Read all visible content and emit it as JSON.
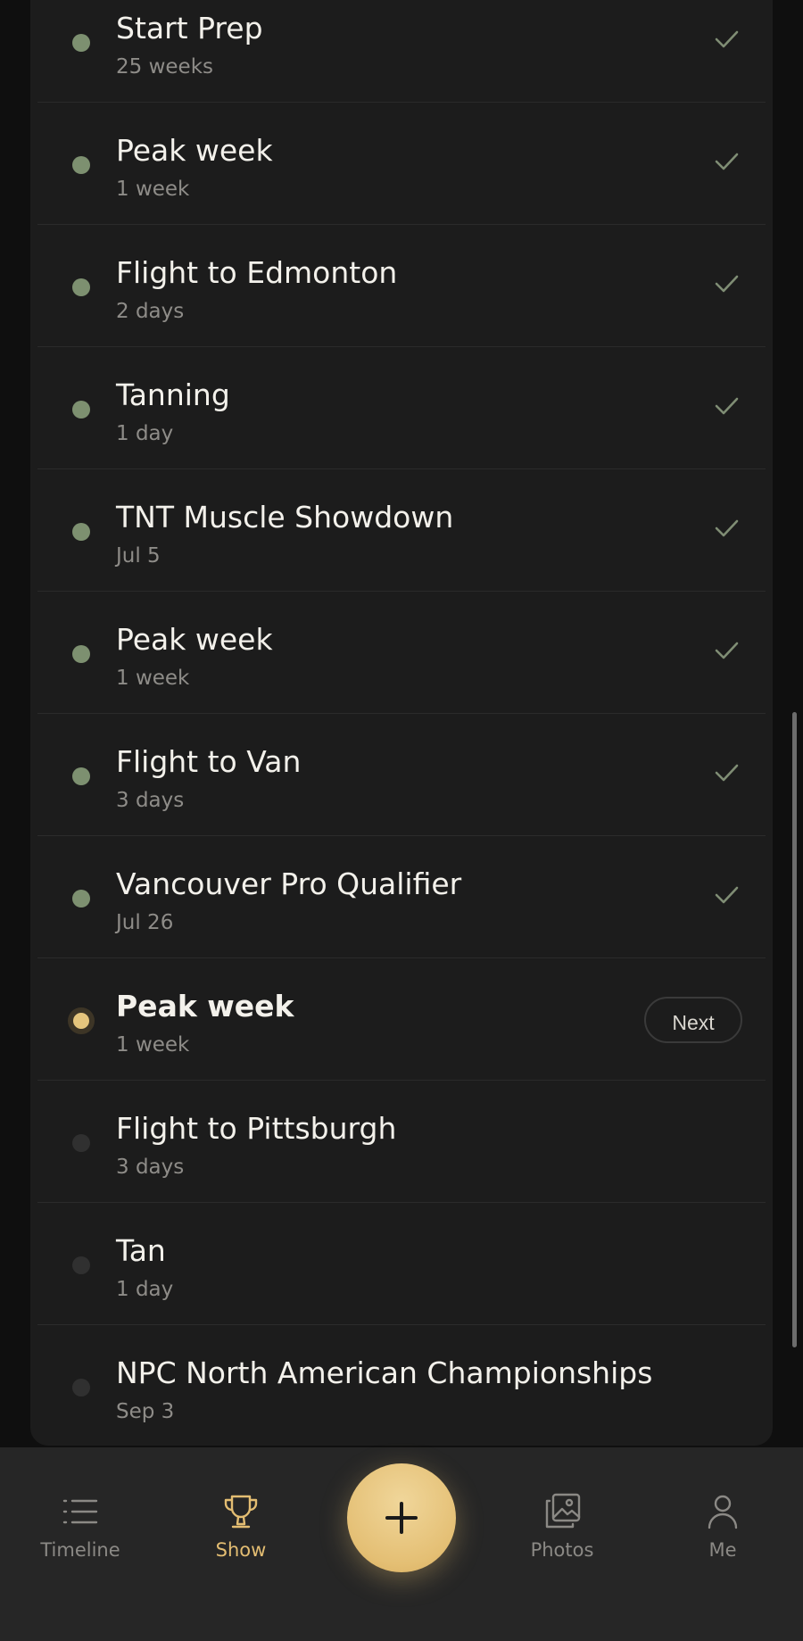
{
  "timeline": [
    {
      "title": "Start Prep",
      "subtitle": "25 weeks",
      "status": "done"
    },
    {
      "title": "Peak week",
      "subtitle": "1 week",
      "status": "done"
    },
    {
      "title": "Flight to Edmonton",
      "subtitle": "2 days",
      "status": "done"
    },
    {
      "title": "Tanning",
      "subtitle": "1 day",
      "status": "done"
    },
    {
      "title": "TNT Muscle Showdown",
      "subtitle": "Jul 5",
      "status": "done"
    },
    {
      "title": "Peak week",
      "subtitle": "1 week",
      "status": "done"
    },
    {
      "title": "Flight to Van",
      "subtitle": "3 days",
      "status": "done"
    },
    {
      "title": "Vancouver Pro Qualifier",
      "subtitle": "Jul 26",
      "status": "done"
    },
    {
      "title": "Peak week",
      "subtitle": "1 week",
      "status": "current",
      "action_label": "Next"
    },
    {
      "title": "Flight to Pittsburgh",
      "subtitle": "3 days",
      "status": "pending"
    },
    {
      "title": "Tan",
      "subtitle": "1 day",
      "status": "pending"
    },
    {
      "title": "NPC North American Championships",
      "subtitle": "Sep 3",
      "status": "pending"
    }
  ],
  "colors": {
    "done_dot": "#7d9070",
    "current_dot": "#e5c57d",
    "pending_dot": "#303030",
    "accent": "#e3bd72"
  },
  "tabbar": {
    "timeline_label": "Timeline",
    "show_label": "Show",
    "photos_label": "Photos",
    "me_label": "Me",
    "active": "Show",
    "fab_icon": "plus-icon"
  }
}
